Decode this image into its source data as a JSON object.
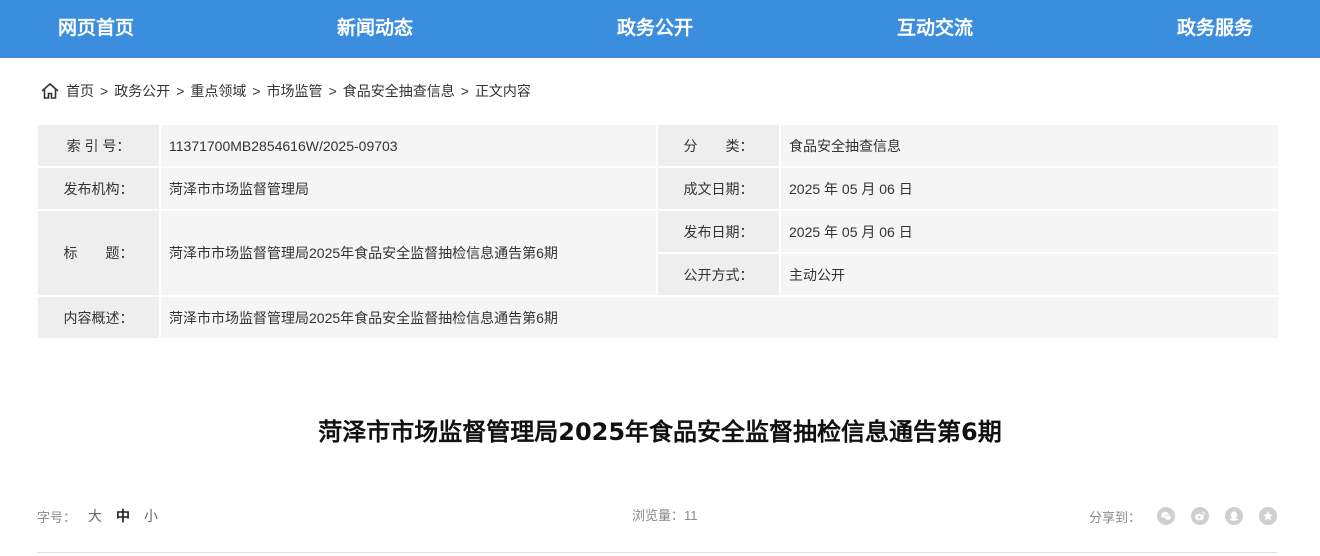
{
  "nav": {
    "items": [
      "网页首页",
      "新闻动态",
      "政务公开",
      "互动交流",
      "政务服务"
    ]
  },
  "breadcrumb": {
    "items": [
      "首页",
      "政务公开",
      "重点领域",
      "市场监管",
      "食品安全抽查信息",
      "正文内容"
    ],
    "separator": ">"
  },
  "meta": {
    "index_label": "索 引 号：",
    "index_value": "11371700MB2854616W/2025-09703",
    "category_label": "分　　类：",
    "category_value": "食品安全抽查信息",
    "publisher_label": "发布机构：",
    "publisher_value": "菏泽市市场监督管理局",
    "written_date_label": "成文日期：",
    "written_date_value": "2025 年 05 月 06 日",
    "title_label": "标　　题：",
    "title_value": "菏泽市市场监督管理局2025年食品安全监督抽检信息通告第6期",
    "publish_date_label": "发布日期：",
    "publish_date_value": "2025 年 05 月 06 日",
    "disclosure_label": "公开方式：",
    "disclosure_value": "主动公开",
    "summary_label": "内容概述：",
    "summary_value": "菏泽市市场监督管理局2025年食品安全监督抽检信息通告第6期"
  },
  "article": {
    "title": "菏泽市市场监督管理局2025年食品安全监督抽检信息通告第6期"
  },
  "toolbar": {
    "font_size_label": "字号：",
    "font_large": "大",
    "font_medium": "中",
    "font_small": "小",
    "views_text": "浏览量：11",
    "share_label": "分享到：",
    "share_icons": [
      "wechat-icon",
      "weibo-icon",
      "qq-icon",
      "qzone-icon"
    ]
  },
  "colors": {
    "nav_bg": "#3b8ede",
    "label_bg": "#eeeeee",
    "value_bg": "#f5f5f5"
  }
}
